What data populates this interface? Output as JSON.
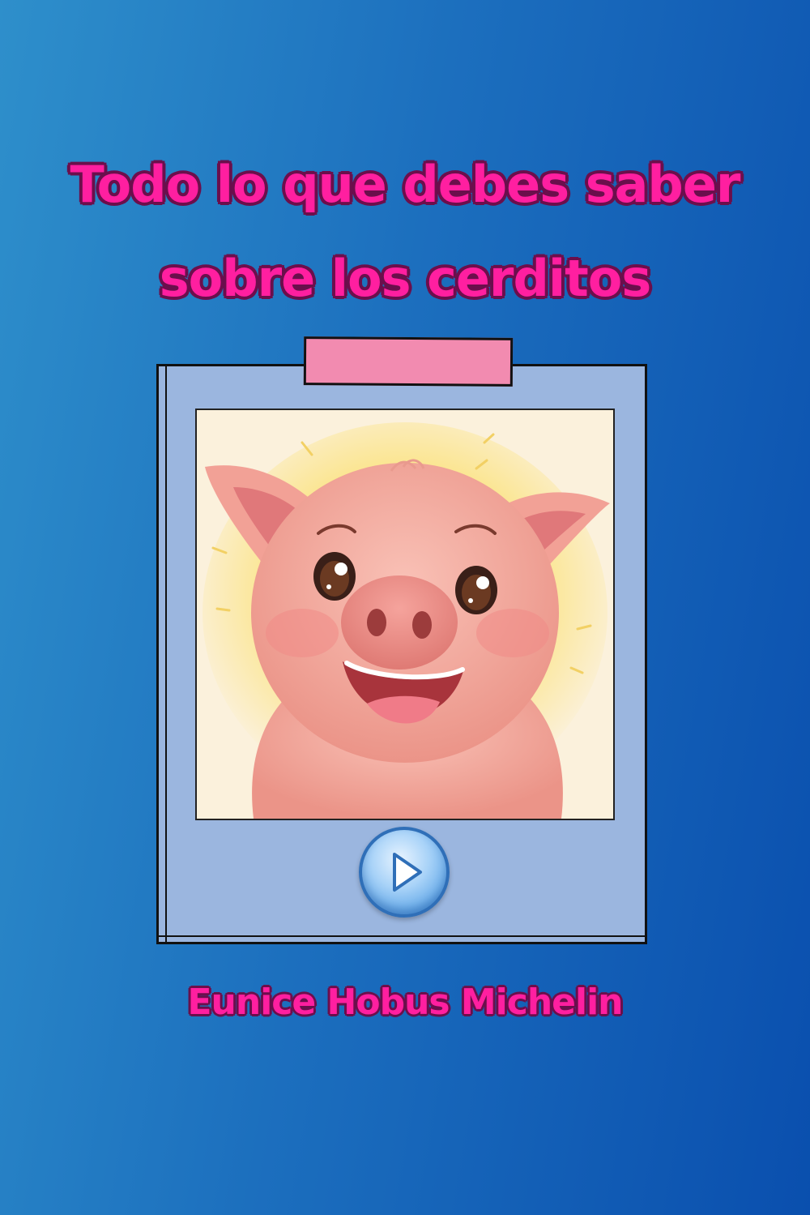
{
  "cover": {
    "title_line1": "Todo lo que debes saber",
    "title_line2": "sobre los cerditos",
    "author": "Eunice Hobus Michelin"
  },
  "illustration": {
    "subject": "smiling-pig",
    "button_icon": "play-icon"
  },
  "colors": {
    "background_left": "#2e8fcb",
    "background_right": "#0a4fae",
    "title_fill": "#ff1fa0",
    "title_outline": "#6b0f4c",
    "frame": "#9bb6df",
    "tape": "#f28bb0",
    "pig": "#f4a9a0"
  }
}
